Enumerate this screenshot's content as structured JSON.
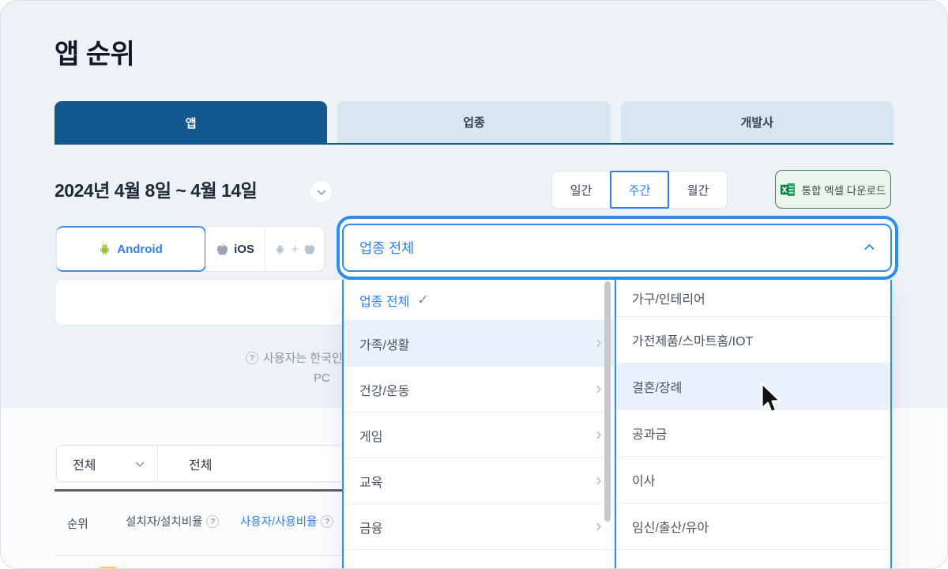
{
  "page": {
    "title": "앱 순위"
  },
  "tabs": {
    "app": "앱",
    "industry": "업종",
    "developer": "개발사",
    "active": "앱"
  },
  "date_filter": {
    "range": "2024년 4월 8일 ~ 4월 14일"
  },
  "period_toggle": {
    "daily": "일간",
    "weekly": "주간",
    "monthly": "월간",
    "selected": "주간"
  },
  "excel_button": {
    "label": "통합 엑셀 다운로드"
  },
  "platform_toggle": {
    "android": "Android",
    "ios": "iOS",
    "combined_separator": "+",
    "selected": "Android"
  },
  "category_dropdown": {
    "value": "업종 전체",
    "state": "open",
    "left_items": [
      "업종 전체",
      "가족/생활",
      "건강/운동",
      "게임",
      "교육",
      "금융"
    ],
    "left_selected": "업종 전체",
    "left_hovered": "가족/생활",
    "right_items": [
      "가구/인테리어",
      "가전제품/스마트홈/IOT",
      "결혼/장례",
      "공과금",
      "이사",
      "임신/출산/유아"
    ],
    "right_hovered": "결혼/장례"
  },
  "helper_note": {
    "line1": "사용자는 한국인",
    "line2": "PC"
  },
  "app_filter": {
    "select1": "전체",
    "select2": "전체"
  },
  "table": {
    "headers": {
      "rank": "순위",
      "installs": "설치자/설치비율",
      "users": "사용자/사용비율"
    }
  },
  "icons": {
    "check": "✓",
    "question": "?"
  },
  "colors": {
    "accent_blue": "#2f80ed",
    "focus_ring": "#2f8df2",
    "tab_active_blue": "#11598f",
    "row_highlight": "#e9f2fc",
    "excel_green": "#217346",
    "app_icon_yellow": "#f6d90a"
  }
}
